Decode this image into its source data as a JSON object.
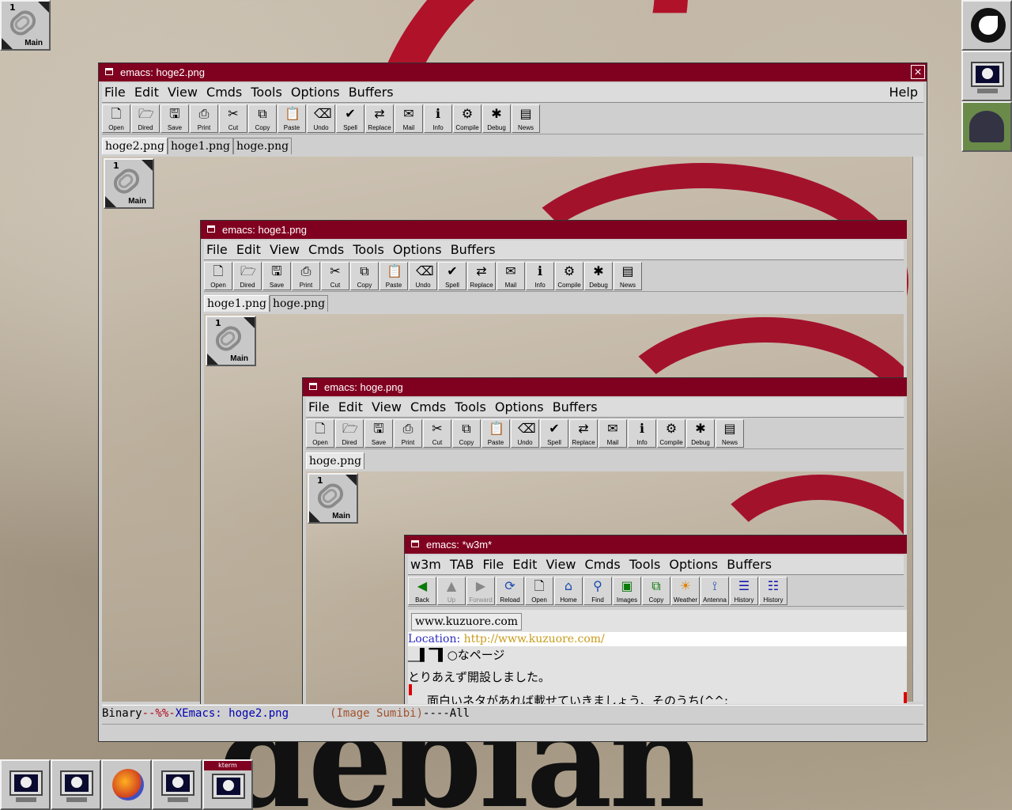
{
  "desktop": {
    "brand_text": "debian",
    "top_left_icon": {
      "number": "1",
      "label": "Main"
    },
    "dock_labels": {
      "kterm": "kterm"
    }
  },
  "toolbar_buttons": [
    "Open",
    "Dired",
    "Save",
    "Print",
    "Cut",
    "Copy",
    "Paste",
    "Undo",
    "Spell",
    "Replace",
    "Mail",
    "Info",
    "Compile",
    "Debug",
    "News"
  ],
  "windows": {
    "hoge2": {
      "title": "emacs: hoge2.png",
      "menu": [
        "File",
        "Edit",
        "View",
        "Cmds",
        "Tools",
        "Options",
        "Buffers"
      ],
      "help": "Help",
      "tabs": [
        "hoge2.png",
        "hoge1.png",
        "hoge.png"
      ],
      "icon": {
        "number": "1",
        "label": "Main"
      },
      "modeline": {
        "prefix": "Binary",
        "flags": "--%%-",
        "app": "XEmacs: ",
        "buffer": "hoge2.png",
        "mode": "(Image Sumibi)",
        "tail": "----All"
      }
    },
    "hoge1": {
      "title": "emacs: hoge1.png",
      "menu": [
        "File",
        "Edit",
        "View",
        "Cmds",
        "Tools",
        "Options",
        "Buffers"
      ],
      "tabs": [
        "hoge1.png",
        "hoge.png"
      ],
      "icon": {
        "number": "1",
        "label": "Main"
      }
    },
    "hoge": {
      "title": "emacs: hoge.png",
      "menu": [
        "File",
        "Edit",
        "View",
        "Cmds",
        "Tools",
        "Options",
        "Buffers"
      ],
      "tabs": [
        "hoge.png"
      ],
      "icon": {
        "number": "1",
        "label": "Main"
      }
    },
    "w3m": {
      "title": "emacs: *w3m*",
      "menu": [
        "w3m",
        "TAB",
        "File",
        "Edit",
        "View",
        "Cmds",
        "Tools",
        "Options",
        "Buffers"
      ],
      "toolbar": [
        "Back",
        "Up",
        "Forward",
        "Reload",
        "Open",
        "Home",
        "Find",
        "Images",
        "Copy",
        "Weather",
        "Antenna",
        "History",
        "History"
      ],
      "tab": "www.kuzuore.com",
      "location_label": "Location: ",
      "location_url": "http://www.kuzuore.com/",
      "lines": [
        "__▌▔▌○なページ",
        "とりあえず開設しました。",
        "面白いネタがあれば載せていきましょう、そのうち(^^;"
      ]
    }
  }
}
